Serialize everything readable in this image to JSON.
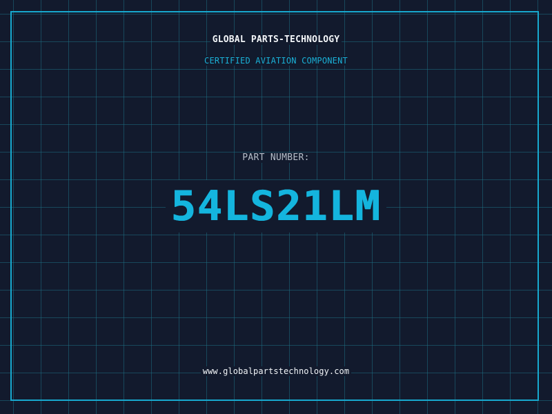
{
  "header": {
    "brand": "GLOBAL PARTS-TECHNOLOGY",
    "tagline": "CERTIFIED AVIATION COMPONENT"
  },
  "part": {
    "label": "PART NUMBER:",
    "number": "54LS21LM"
  },
  "footer": {
    "url": "www.globalpartstechnology.com"
  },
  "colors": {
    "background": "#121a2d",
    "accent": "#17a9cf",
    "grid": "#1e6e82",
    "text": "#f2f5f8",
    "muted": "#b7bfca"
  }
}
